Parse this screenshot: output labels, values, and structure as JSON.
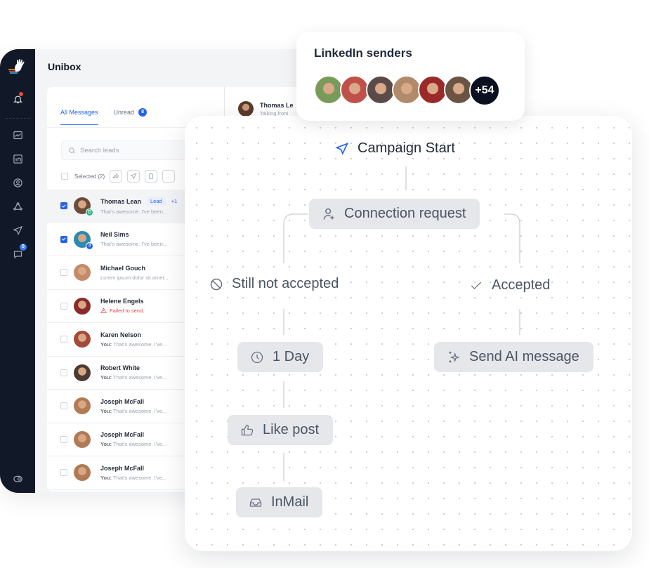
{
  "app": {
    "title": "Unibox",
    "sidebar": {
      "icons": [
        "logo-hand-icon",
        "bell-icon",
        "analytics-icon",
        "linkedin-icon",
        "user-circle-icon",
        "network-icon",
        "send-icon",
        "chat-icon",
        "settings-toggle-icon"
      ],
      "chat_badge": "5"
    },
    "tabs": [
      {
        "label": "All Messages",
        "active": true
      },
      {
        "label": "Unread",
        "count": "8",
        "active": false
      }
    ],
    "search": {
      "placeholder": "Search leads",
      "value": ""
    },
    "selected_label": "Selected (2)",
    "toolbar_icons": [
      "forward-icon",
      "send-icon",
      "clipboard-icon",
      "more-icon"
    ],
    "conversations": [
      {
        "name": "Thomas Lean",
        "tag": "Lead",
        "extra": "+1",
        "preview_prefix": "",
        "preview": "That's awesome. I've been...",
        "checked": true,
        "highlight": true,
        "badge": "alarm",
        "badge_color": "#10b981",
        "avatar_color": "#6b4b3a",
        "error": false
      },
      {
        "name": "Neil Sims",
        "tag": "",
        "extra": "",
        "preview_prefix": "",
        "preview": "That's awesome. I've been...",
        "checked": true,
        "highlight": false,
        "badge": "3",
        "badge_color": "#2563eb",
        "avatar_color": "#2b8ab0",
        "error": false
      },
      {
        "name": "Michael Gouch",
        "tag": "",
        "extra": "",
        "preview_prefix": "",
        "preview": "Lorem ipsum dolor sit amet...",
        "checked": false,
        "highlight": false,
        "badge": "",
        "badge_color": "",
        "avatar_color": "#c48a6a",
        "error": false
      },
      {
        "name": "Helene Engels",
        "tag": "",
        "extra": "",
        "preview_prefix": "",
        "preview": "Failed to send.",
        "checked": false,
        "highlight": false,
        "badge": "",
        "badge_color": "",
        "avatar_color": "#8b2a2a",
        "error": true
      },
      {
        "name": "Karen Nelson",
        "tag": "",
        "extra": "",
        "preview_prefix": "You:",
        "preview": " That's awesome. I've...",
        "checked": false,
        "highlight": false,
        "badge": "",
        "badge_color": "",
        "avatar_color": "#a34a3a",
        "error": false
      },
      {
        "name": "Robert White",
        "tag": "",
        "extra": "",
        "preview_prefix": "You:",
        "preview": " That's awesome. I've...",
        "checked": false,
        "highlight": false,
        "badge": "",
        "badge_color": "",
        "avatar_color": "#4b3b33",
        "error": false
      },
      {
        "name": "Joseph McFall",
        "tag": "",
        "extra": "",
        "preview_prefix": "You:",
        "preview": " That's awesome. I've...",
        "checked": false,
        "highlight": false,
        "badge": "",
        "badge_color": "",
        "avatar_color": "#b07a55",
        "error": false
      },
      {
        "name": "Joseph McFall",
        "tag": "",
        "extra": "",
        "preview_prefix": "You:",
        "preview": " That's awesome. I've...",
        "checked": false,
        "highlight": false,
        "badge": "",
        "badge_color": "",
        "avatar_color": "#b07a55",
        "error": false
      },
      {
        "name": "Joseph McFall",
        "tag": "",
        "extra": "",
        "preview_prefix": "You:",
        "preview": " That's awesome. I've...",
        "checked": false,
        "highlight": false,
        "badge": "",
        "badge_color": "",
        "avatar_color": "#b07a55",
        "error": false
      }
    ],
    "chat_header": {
      "name": "Thomas Le",
      "subtitle": "Talking from"
    }
  },
  "senders": {
    "title": "LinkedIn senders",
    "avatar_colors": [
      "#7a9a5a",
      "#c0504a",
      "#5a4a48",
      "#b08a6a",
      "#9a2a2a",
      "#6b5444"
    ],
    "more_count": "+54"
  },
  "flow": {
    "start": {
      "label": "Campaign Start",
      "icon": "send-icon"
    },
    "connection": {
      "label": "Connection request",
      "icon": "user-plus-icon"
    },
    "not_accepted": {
      "label": "Still not accepted",
      "icon": "ban-icon"
    },
    "accepted": {
      "label": "Accepted",
      "icon": "check-icon"
    },
    "wait": {
      "label": "1 Day",
      "icon": "clock-icon"
    },
    "ai_message": {
      "label": "Send AI message",
      "icon": "sparkles-icon"
    },
    "like": {
      "label": "Like post",
      "icon": "thumbs-up-icon"
    },
    "inmail": {
      "label": "InMail",
      "icon": "inbox-icon"
    }
  },
  "colors": {
    "sidebar": "#111827",
    "accent": "#2563eb",
    "error": "#ef4444",
    "node_bg": "#e5e7eb"
  }
}
